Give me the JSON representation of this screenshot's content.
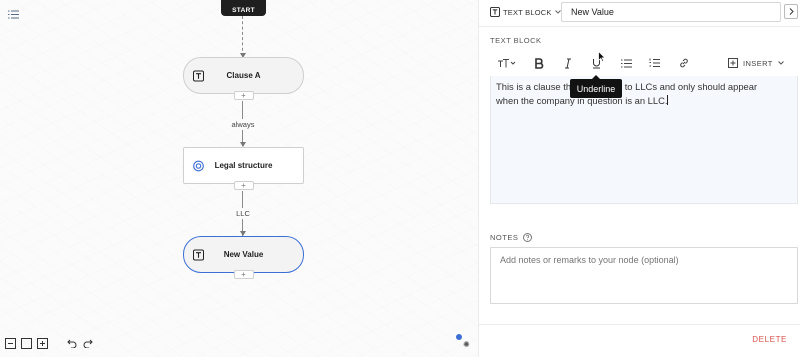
{
  "canvas": {
    "start_label": "START",
    "nodes": [
      {
        "title": "Clause A",
        "icon": "text-block-icon"
      },
      {
        "title": "Legal structure",
        "icon": "target-icon"
      },
      {
        "title": "New Value",
        "icon": "text-block-icon"
      }
    ],
    "edges": [
      {
        "label": "always"
      },
      {
        "label": "LLC"
      }
    ],
    "plus": "+",
    "accent_color": "#3b6fd4"
  },
  "panel": {
    "type_label": "TEXT BLOCK",
    "title_value": "New Value",
    "section_label": "TEXT BLOCK",
    "toolbar": {
      "insert_label": "INSERT",
      "tooltip": "Underline"
    },
    "editor_text_line1": "This is a clause that is specific to LLCs and only should appear",
    "editor_text_line2": "when the company in question is an LLC.",
    "notes_label": "NOTES",
    "notes_placeholder": "Add notes or remarks to your node (optional)",
    "delete_label": "DELETE",
    "delete_color": "#d9534f"
  }
}
